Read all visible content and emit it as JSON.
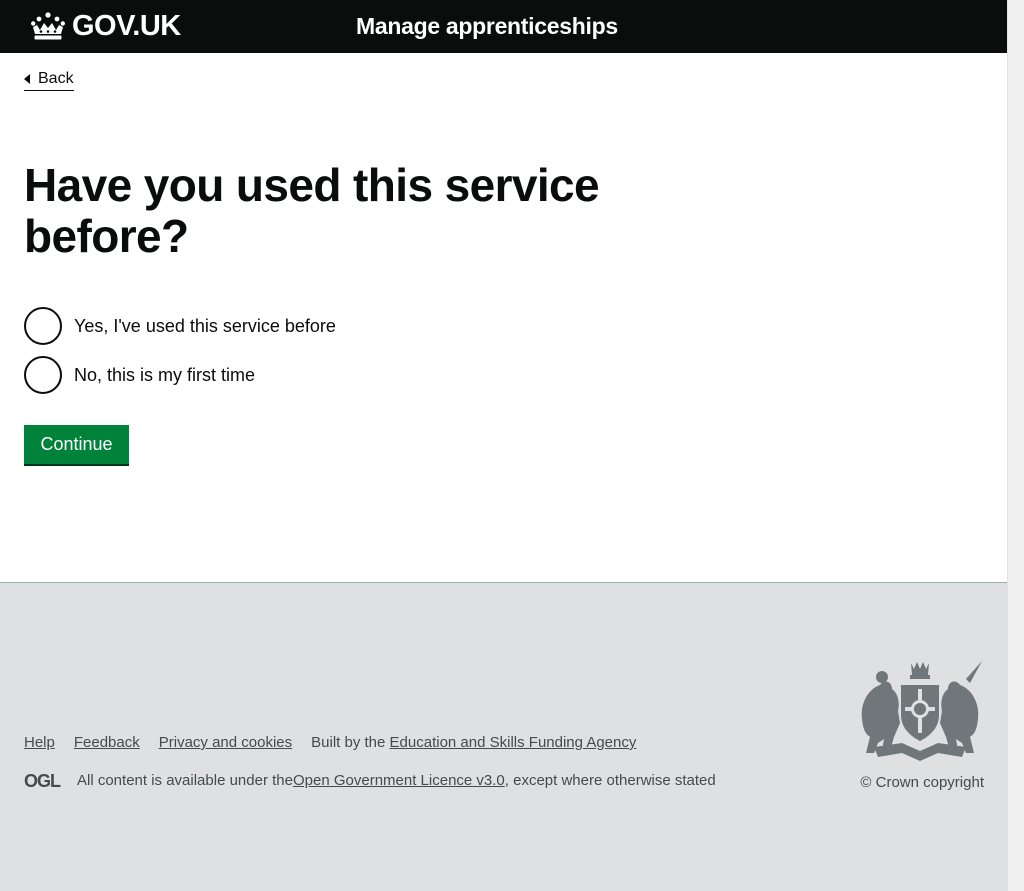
{
  "header": {
    "logo_text": "GOV.UK",
    "service_name": "Manage apprenticeships"
  },
  "main": {
    "back_label": "Back",
    "heading": "Have you used this service before?",
    "radios": [
      {
        "label": "Yes, I've used this service before",
        "checked": false
      },
      {
        "label": "No, this is my first time",
        "checked": false
      }
    ],
    "continue_label": "Continue"
  },
  "footer": {
    "links": [
      "Help",
      "Feedback",
      "Privacy and cookies"
    ],
    "built_by_prefix": "Built by the ",
    "built_by_link": "Education and Skills Funding Agency",
    "ogl_label": "OGL",
    "licence_prefix": "All content is available under the ",
    "licence_link": "Open Government Licence v3.0",
    "licence_suffix": ", except where otherwise stated",
    "copyright": "© Crown copyright"
  },
  "colors": {
    "header_bg": "#0b0c0c",
    "button_green": "#00823b",
    "footer_bg": "#dee0e2"
  },
  "icons": {
    "logo": "crown-icon",
    "back": "chevron-left-icon",
    "licence": "ogl-logo",
    "crest": "royal-coat-of-arms"
  }
}
